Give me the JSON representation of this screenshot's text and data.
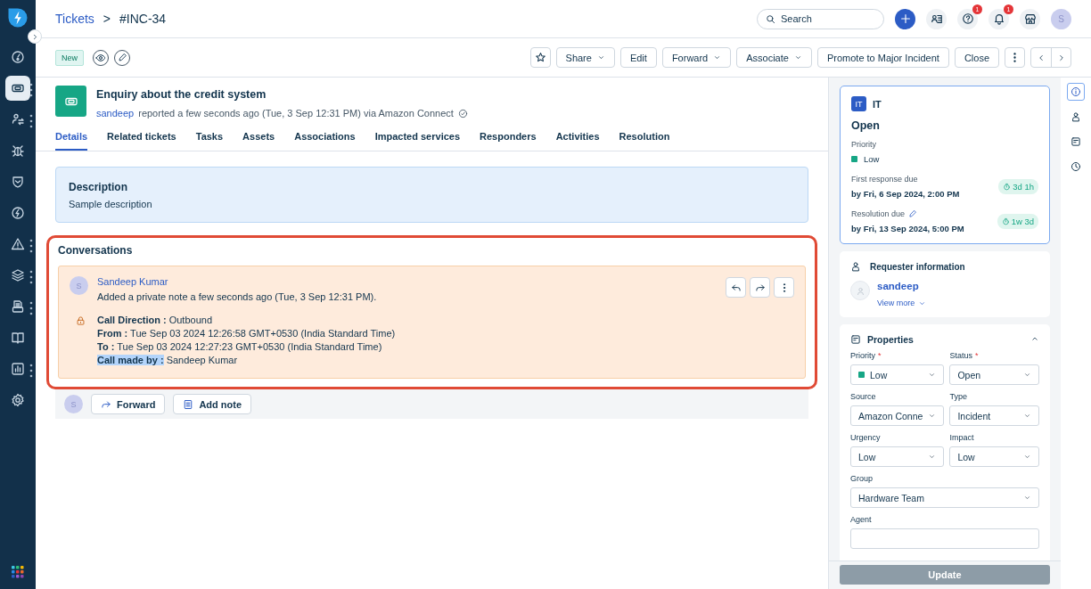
{
  "sidebar": {
    "items": [
      {
        "kind": "gauge",
        "selected": false,
        "has_menu": false
      },
      {
        "kind": "ticket",
        "selected": true,
        "has_menu": true
      },
      {
        "kind": "swap",
        "selected": false,
        "has_menu": true
      },
      {
        "kind": "bug",
        "selected": false,
        "has_menu": false
      },
      {
        "kind": "shield",
        "selected": false,
        "has_menu": false
      },
      {
        "kind": "bolt",
        "selected": false,
        "has_menu": false
      },
      {
        "kind": "warning",
        "selected": false,
        "has_menu": true
      },
      {
        "kind": "layers",
        "selected": false,
        "has_menu": true
      },
      {
        "kind": "printer",
        "selected": false,
        "has_menu": true
      },
      {
        "kind": "book",
        "selected": false,
        "has_menu": false
      },
      {
        "kind": "chart",
        "selected": false,
        "has_menu": true
      },
      {
        "kind": "gear",
        "selected": false,
        "has_menu": false
      }
    ]
  },
  "breadcrumb": {
    "parent": "Tickets",
    "separator": ">",
    "current": "#INC-34"
  },
  "header": {
    "search": {
      "placeholder": "Search"
    },
    "avatar": "S",
    "badges": [
      {
        "kind": "help",
        "count": "1"
      },
      {
        "kind": "bell",
        "count": "1"
      }
    ]
  },
  "toolbar": {
    "status_tag": "New",
    "buttons": [
      {
        "kind": "star"
      },
      {
        "kind": "dropdown",
        "label": "Share"
      },
      {
        "kind": "plain",
        "label": "Edit"
      },
      {
        "kind": "dropdown",
        "label": "Forward"
      },
      {
        "kind": "dropdown",
        "label": "Associate"
      },
      {
        "kind": "plain",
        "label": "Promote to Major Incident"
      },
      {
        "kind": "plain",
        "label": "Close"
      },
      {
        "kind": "more"
      },
      {
        "kind": "pager"
      }
    ]
  },
  "ticket": {
    "subject": "Enquiry about the credit system",
    "requester": "sandeep",
    "meta": "reported a few seconds ago (Tue, 3 Sep 12:31 PM) via Amazon Connect"
  },
  "tabs": [
    {
      "label": "Details",
      "selected": true
    },
    {
      "label": "Related tickets",
      "selected": false
    },
    {
      "label": "Tasks",
      "selected": false
    },
    {
      "label": "Assets",
      "selected": false
    },
    {
      "label": "Associations",
      "selected": false
    },
    {
      "label": "Impacted services",
      "selected": false
    },
    {
      "label": "Responders",
      "selected": false
    },
    {
      "label": "Activities",
      "selected": false
    },
    {
      "label": "Resolution",
      "selected": false
    }
  ],
  "description": {
    "title": "Description",
    "text": "Sample description"
  },
  "conversations": {
    "title": "Conversations",
    "highlighted": true,
    "notes": [
      {
        "avatar": "S",
        "author": "Sandeep Kumar",
        "summary": "Added a private note a few seconds ago (Tue, 3 Sep 12:31 PM).",
        "private": true,
        "lines": [
          {
            "label": "Call Direction :",
            "value": "Outbound",
            "selected": false
          },
          {
            "label": "From :",
            "value": "Tue Sep 03 2024 12:26:58 GMT+0530 (India Standard Time)",
            "selected": false
          },
          {
            "label": "To :",
            "value": "Tue Sep 03 2024 12:27:23 GMT+0530 (India Standard Time)",
            "selected": false
          },
          {
            "label": "Call made by :",
            "value": "Sandeep Kumar",
            "selected": true
          }
        ]
      }
    ],
    "reply_bar": {
      "avatar": "S",
      "buttons": [
        {
          "kind": "forward",
          "label": "Forward"
        },
        {
          "kind": "note",
          "label": "Add note"
        }
      ]
    }
  },
  "summary": {
    "workspace_badge": "IT",
    "workspace": "IT",
    "status": "Open",
    "priority_label": "Priority",
    "priority": {
      "label": "Low",
      "color": "#16a685"
    },
    "sla": [
      {
        "label": "First response due",
        "editable": false,
        "due": "by Fri, 6 Sep 2024, 2:00 PM",
        "remaining": "3d 1h"
      },
      {
        "label": "Resolution due",
        "editable": true,
        "due": "by Fri, 13 Sep 2024, 5:00 PM",
        "remaining": "1w 3d"
      }
    ]
  },
  "requester": {
    "title": "Requester information",
    "name": "sandeep",
    "view_more": "View more"
  },
  "properties": {
    "title": "Properties",
    "expanded": true,
    "fields": [
      {
        "kind": "half",
        "label": "Priority",
        "required_mark": "*",
        "value": "Low",
        "color": "#16a685"
      },
      {
        "kind": "half",
        "label": "Status",
        "required_mark": "*",
        "value": "Open"
      },
      {
        "kind": "half",
        "label": "Source",
        "value": "Amazon Conne"
      },
      {
        "kind": "half",
        "label": "Type",
        "value": "Incident"
      },
      {
        "kind": "half",
        "label": "Urgency",
        "value": "Low"
      },
      {
        "kind": "half",
        "label": "Impact",
        "value": "Low"
      },
      {
        "kind": "full",
        "label": "Group",
        "value": "Hardware Team"
      },
      {
        "kind": "full",
        "label": "Agent"
      }
    ],
    "update_button": "Update",
    "update_disabled": true
  },
  "rail": [
    {
      "kind": "info",
      "selected": true
    },
    {
      "kind": "person",
      "selected": false
    },
    {
      "kind": "notes",
      "selected": false
    },
    {
      "kind": "clock",
      "selected": false
    }
  ]
}
